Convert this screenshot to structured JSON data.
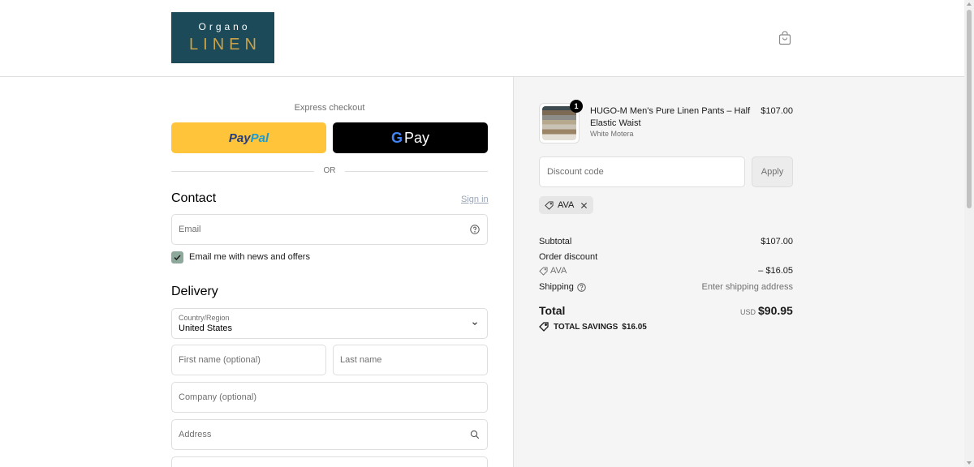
{
  "header": {
    "logo_line1": "Organo",
    "logo_line2": "LINEN",
    "cart_icon": "shopping-bag-icon"
  },
  "express": {
    "label": "Express checkout",
    "paypal_part1": "Pay",
    "paypal_part2": "Pal",
    "gpay_g": "G",
    "gpay_label": "Pay",
    "or_label": "OR"
  },
  "contact": {
    "heading": "Contact",
    "signin": "Sign in",
    "email_placeholder": "Email",
    "newsletter_label": "Email me with news and offers",
    "newsletter_checked": true
  },
  "delivery": {
    "heading": "Delivery",
    "country_label": "Country/Region",
    "country_value": "United States",
    "first_name_placeholder": "First name (optional)",
    "last_name_placeholder": "Last name",
    "company_placeholder": "Company (optional)",
    "address_placeholder": "Address"
  },
  "order": {
    "item": {
      "quantity": "1",
      "name": "HUGO-M Men's Pure Linen Pants – Half Elastic Waist",
      "variant": "White Motera",
      "price": "$107.00"
    },
    "discount_placeholder": "Discount code",
    "apply_label": "Apply",
    "applied_code": "AVA",
    "subtotal_label": "Subtotal",
    "subtotal_value": "$107.00",
    "order_discount_label": "Order discount",
    "discount_code": "AVA",
    "discount_value": "– $16.05",
    "shipping_label": "Shipping",
    "shipping_value": "Enter shipping address",
    "total_label": "Total",
    "total_currency": "USD",
    "total_value": "$90.95",
    "savings_label": "TOTAL SAVINGS",
    "savings_value": "$16.05"
  },
  "colors": {
    "paypal_yellow": "#ffc439",
    "logo_bg": "#1d4a58",
    "logo_gold": "#c9a24a",
    "checkbox": "#8ea89b"
  }
}
